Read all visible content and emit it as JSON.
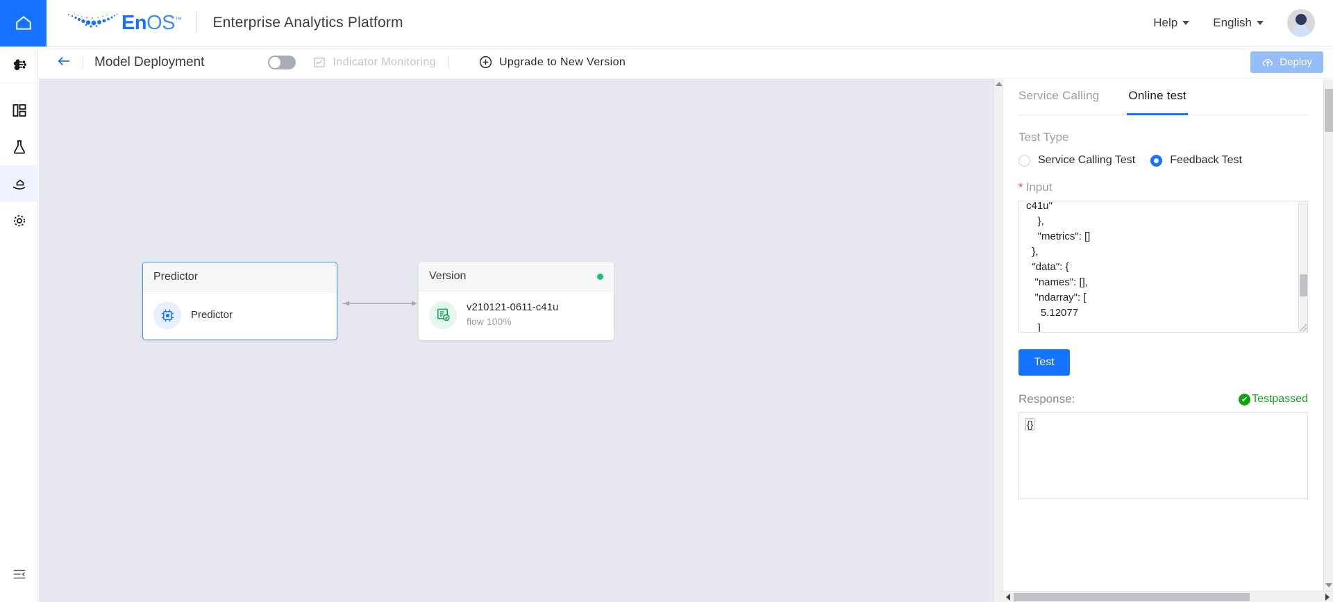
{
  "header": {
    "home_icon": "home-icon",
    "logo_text_primary": "En",
    "logo_text_secondary": "OS",
    "logo_tm": "™",
    "platform_title": "Enterprise Analytics Platform",
    "help_label": "Help",
    "language_label": "English"
  },
  "subheader": {
    "back_icon": "arrow-left-icon",
    "page_title": "Model Deployment",
    "toggle_on": false,
    "indicator_monitoring_label": "Indicator Monitoring",
    "indicator_monitoring_icon": "chart-line-icon",
    "upgrade_label": "Upgrade to New Version",
    "upgrade_icon": "plus-circle-icon",
    "deploy_label": "Deploy",
    "deploy_icon": "cloud-upload-icon"
  },
  "sidebar": {
    "items": [
      {
        "name": "ai-model-icon",
        "label": "AI Model",
        "active": false
      },
      {
        "name": "dashboard-icon",
        "label": "Dashboard",
        "active": false
      },
      {
        "name": "lab-flask-icon",
        "label": "Experiments",
        "active": false
      },
      {
        "name": "model-serving-icon",
        "label": "Model Serving",
        "active": true
      },
      {
        "name": "settings-gear-icon",
        "label": "Settings",
        "active": false
      }
    ],
    "collapse_icon": "collapse-panel-icon"
  },
  "canvas": {
    "nodes": [
      {
        "title": "Predictor",
        "icon": "predictor-icon",
        "main_text": "Predictor",
        "sub_text": "",
        "selected": true,
        "status": null
      },
      {
        "title": "Version",
        "icon": "version-doc-check-icon",
        "main_text": "v210121-0611-c41u",
        "sub_text": "flow 100%",
        "selected": false,
        "status": "online"
      }
    ],
    "edge_icon": "arrow-connector-icon"
  },
  "panel": {
    "tabs": [
      {
        "label": "Service Calling",
        "active": false
      },
      {
        "label": "Online test",
        "active": true
      }
    ],
    "test_type_label": "Test Type",
    "test_type_options": [
      {
        "label": "Service Calling Test",
        "checked": false
      },
      {
        "label": "Feedback Test",
        "checked": true
      }
    ],
    "input_label": "Input",
    "input_required_mark": "*",
    "input_value": "c41u\"\n    },\n    \"metrics\": []\n  },\n  \"data\": {\n   \"names\": [],\n   \"ndarray\": [\n     5.12077\n    ]",
    "test_button_label": "Test",
    "response_label": "Response:",
    "response_status": "Testpassed",
    "response_status_icon": "check-circle-icon",
    "response_value": "{}"
  },
  "colors": {
    "accent": "#1673ff",
    "deploy_disabled": "#95bdf7",
    "success": "#10a310",
    "online_dot": "#1fc16b",
    "canvas_bg": "#e6e7ef",
    "required_star": "#f5445e"
  }
}
